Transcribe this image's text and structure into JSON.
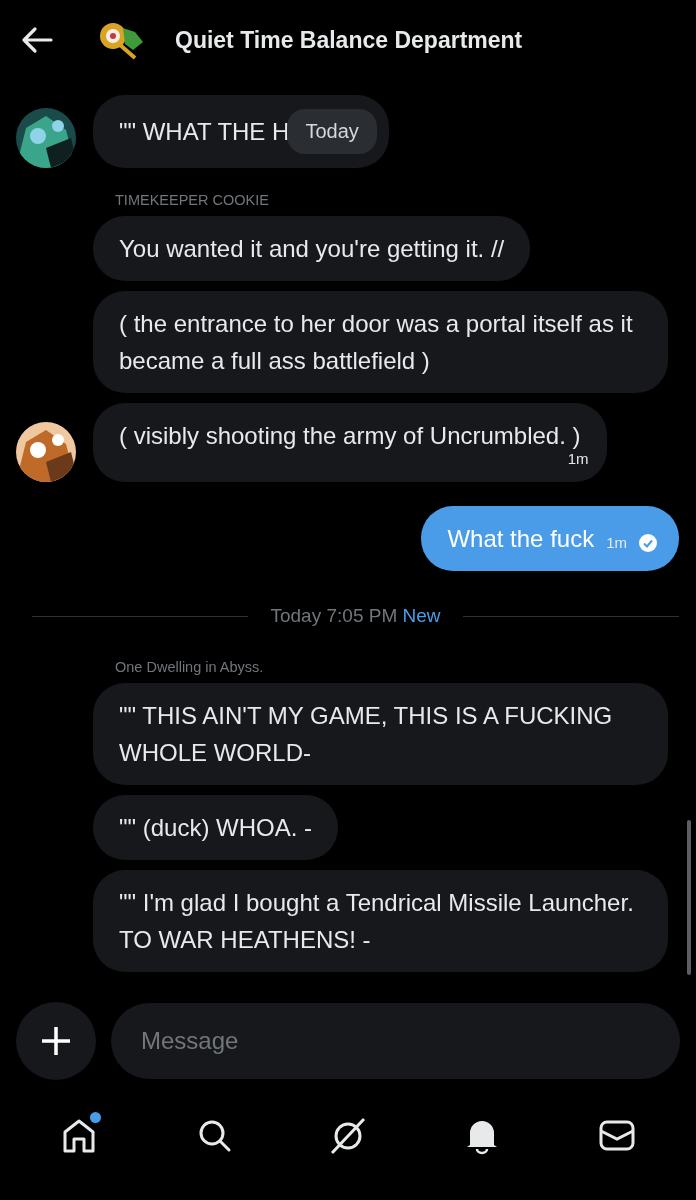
{
  "header": {
    "title": "Quiet Time Balance Department"
  },
  "timeline": [
    {
      "kind": "incoming",
      "messages": [
        {
          "text": "\"\" WHAT THE H",
          "pill": "Today"
        }
      ]
    },
    {
      "kind": "incoming",
      "sender": "TIMEKEEPER COOKIE",
      "messages": [
        {
          "text": "You wanted it and you're getting it. //"
        },
        {
          "text": "( the entrance to her door was a portal itself as it became a full ass battlefield )"
        },
        {
          "text": "( visibly shooting the army of Uncrumbled. )",
          "time": "1m"
        }
      ]
    },
    {
      "kind": "outgoing",
      "messages": [
        {
          "text": "What the fuck",
          "time": "1m",
          "read": true
        }
      ]
    },
    {
      "kind": "divider",
      "text": "Today 7:05 PM",
      "tag": "New"
    },
    {
      "kind": "incoming",
      "sender": "One Dwelling in Abyss.",
      "messages": [
        {
          "text": "\"\" THIS AIN'T MY GAME, THIS IS A FUCKING WHOLE WORLD-"
        },
        {
          "text": "\"\" (duck) WHOA. -"
        },
        {
          "text": "\"\" I'm glad I bought a Tendrical Missile Launcher. TO WAR HEATHENS! -"
        }
      ]
    }
  ],
  "composer": {
    "placeholder": "Message"
  },
  "nav": [
    {
      "kind": "home",
      "dot": true
    },
    {
      "kind": "search",
      "dot": false
    },
    {
      "kind": "slash",
      "dot": false
    },
    {
      "kind": "bell",
      "dot": false
    },
    {
      "kind": "mail",
      "dot": false
    }
  ]
}
